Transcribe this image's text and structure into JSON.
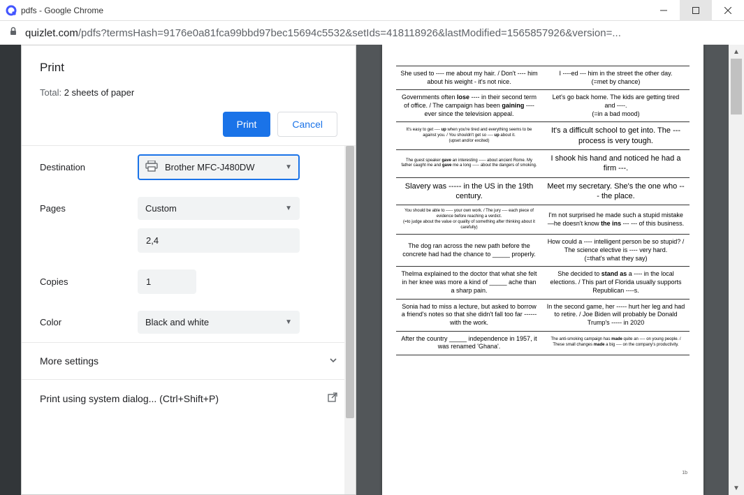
{
  "window": {
    "title": "pdfs - Google Chrome",
    "url_host": "quizlet.com",
    "url_path": "/pdfs?termsHash=9176e0a81fca99bbd97bec15694c5532&setIds=418118926&lastModified=1565857926&version=..."
  },
  "print": {
    "title": "Print",
    "total_prefix": "Total: ",
    "total_value": "2 sheets of paper",
    "print_btn": "Print",
    "cancel_btn": "Cancel",
    "dest_label": "Destination",
    "dest_value": "Brother MFC-J480DW",
    "pages_label": "Pages",
    "pages_mode": "Custom",
    "pages_value": "2,4",
    "copies_label": "Copies",
    "copies_value": "1",
    "color_label": "Color",
    "color_value": "Black and white",
    "more_label": "More settings",
    "sys_label": "Print using system dialog... (Ctrl+Shift+P)"
  },
  "preview": {
    "rows": [
      {
        "l": "She used to ---- me about my hair. / Don't ---- him about his weight - it's not nice.",
        "r": "I ----ed --- him in the street the other day.<br>(=met by chance)"
      },
      {
        "l": "Governments often <b>lose</b> ---- in their second term of office. / The campaign has been <b>gaining</b> ---- ever since the television appeal.",
        "r": "Let's go back home. The kids are getting tired and ----.<br>(=in a bad mood)"
      },
      {
        "l": "It's easy to get ---- <b>up</b> when you're tired and everything seems to be against you. / You shouldn't get so ---- <b>up</b> about it.<br>(upset and/or excited)",
        "r": "It's a difficult school to get into. The --- process is very tough.",
        "ltiny": true,
        "rbig": true
      },
      {
        "l": "The guest speaker <b>gave</b> an interesting ----- about ancient Rome. My father caught me and <b>gave</b> me a long ----- about the dangers of smoking.",
        "r": "I shook his hand and noticed he had a firm ---.",
        "ltiny": true,
        "rbig": true
      },
      {
        "l": "Slavery was ----- in the US in the 19th century.",
        "r": "Meet my secretary. She's the one who --- the place.",
        "lbig": true,
        "rbig": true
      },
      {
        "l": "You should be able to ----- your own work. / The jury ---- each piece of evidence before reaching a verdict.<br>(=to judge about the value or quality of something after thinking about it carefully)",
        "r": "I'm not surprised he made such a stupid mistake—he doesn't know <b>the ins</b> --- --- of this business.",
        "ltiny": true
      },
      {
        "l": "The dog ran across the new path before the concrete had had the chance to _____ properly.",
        "r": "How could a ---- intelligent person be so stupid? / The science elective is ---- very hard.<br>(=that's what they say)"
      },
      {
        "l": "Thelma explained to the doctor that what she felt in her knee was more a kind of _____ ache than a sharp pain.",
        "r": "She decided to <b>stand as</b> a ---- in the local elections. / This part of Florida usually supports Republican ----s."
      },
      {
        "l": "Sonia had to miss a lecture, but asked to borrow a friend's notes so that she didn't fall too far ------ with the work.",
        "r": "In the second game, her ----- hurt her leg and had to retire. / Joe Biden will probably be Donald Trump's ----- in 2020"
      },
      {
        "l": "After the country _____ independence in 1957, it was renamed 'Ghana'.",
        "r": "The anti-smoking campaign has <b>made</b> quite an ---- on young people. / These small changes <b>made</b> a big ---- on the company's productivity.",
        "rtiny": true
      }
    ]
  }
}
